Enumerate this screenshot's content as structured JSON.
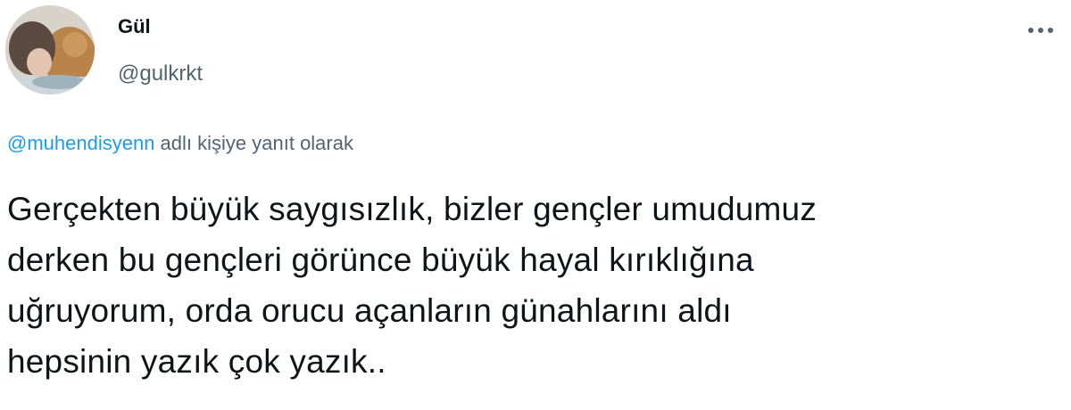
{
  "author": {
    "display_name": "Gül",
    "username": "@gulkrkt"
  },
  "icons": {
    "avatar": "profile-photo",
    "more": "more-horizontal-icon"
  },
  "reply_context": {
    "mention": "@muhendisyenn",
    "suffix": " adlı kişiye yanıt olarak"
  },
  "tweet": {
    "lines": [
      "Gerçekten büyük saygısızlık, bizler gençler umudumuz",
      "derken bu gençleri görünce büyük hayal kırıklığına",
      "uğruyorum, orda orucu açanların günahlarını aldı",
      "hepsinin yazık çok yazık.."
    ]
  },
  "colors": {
    "text_primary": "#0f1419",
    "text_secondary": "#536471",
    "link": "#1d9bf0",
    "background": "#ffffff"
  }
}
